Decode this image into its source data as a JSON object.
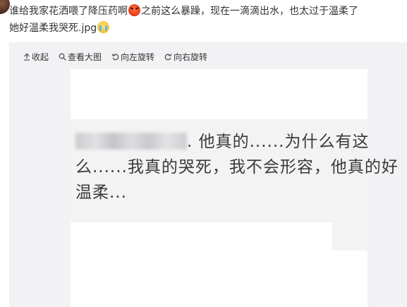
{
  "post": {
    "text_line1_part1": "谁给我家花洒喂了降压药啊",
    "emoji1": "angry-face-emoji",
    "text_line1_part2": "之前这么暴躁，现在一滴滴出水，也太过于温柔了",
    "text_line2": "她好温柔我哭死.jpg",
    "emoji2": "crying-face-emoji"
  },
  "toolbar": {
    "collapse_label": "收起",
    "view_large_label": "查看大图",
    "rotate_left_label": "向左旋转",
    "rotate_right_label": "向右旋转"
  },
  "image": {
    "line1": ". 他真的......为什么有这",
    "line2": "么......我真的哭死，我不会形容，他真的好",
    "line3": "温柔..."
  },
  "colors": {
    "text": "#333333",
    "panel_bg": "#f2f2f5",
    "image_bg": "#ffffff"
  }
}
